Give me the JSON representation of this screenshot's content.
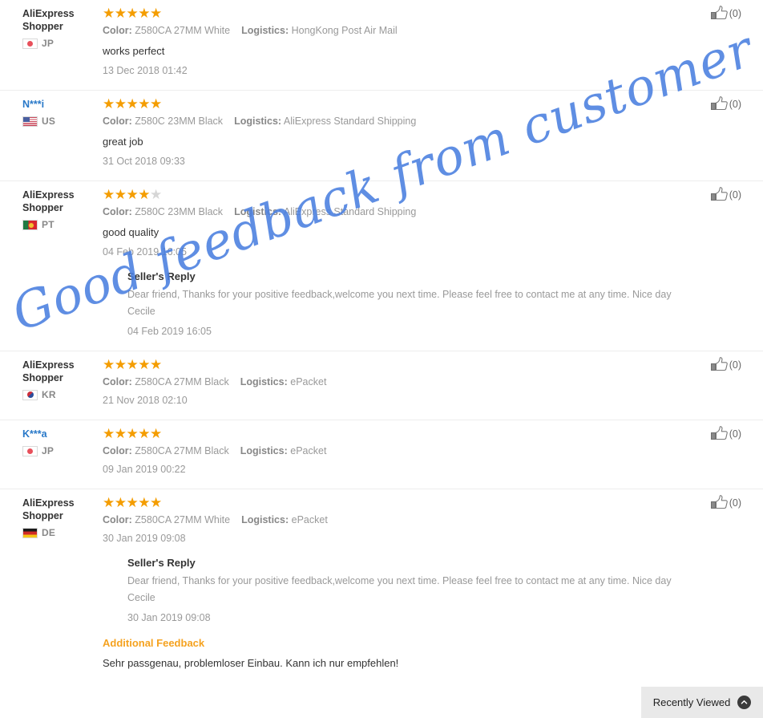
{
  "page": {
    "labels": {
      "color_key": "Color:",
      "logistics_key": "Logistics:",
      "sellers_reply": "Seller's Reply",
      "additional_feedback": "Additional Feedback",
      "helpful_icon": "thumbs-up-icon"
    },
    "colors": {
      "star_on": "#f49d00",
      "star_off": "#d6d6d6",
      "link": "#2878c8",
      "muted": "#999999",
      "accent_orange": "#f5a21f",
      "watermark": "#4a7fe0",
      "divider": "#ededed"
    }
  },
  "watermark": {
    "text": "Good feedback from customer"
  },
  "recently_viewed": {
    "label": "Recently Viewed",
    "icon": "chevron-up-icon"
  },
  "reviews": [
    {
      "user": "AliExpress Shopper",
      "user_is_link": false,
      "country_code": "JP",
      "flag": "flag-jp",
      "rating": 5,
      "color": "Z580CA 27MM White",
      "logistics": "HongKong Post Air Mail",
      "comment": "works perfect",
      "time": "13 Dec 2018 01:42",
      "helpful": "(0)",
      "reply": null,
      "additional": null
    },
    {
      "user": "N***i",
      "user_is_link": true,
      "country_code": "US",
      "flag": "flag-us",
      "rating": 5,
      "color": "Z580C 23MM Black",
      "logistics": "AliExpress Standard Shipping",
      "comment": "great job",
      "time": "31 Oct 2018 09:33",
      "helpful": "(0)",
      "reply": null,
      "additional": null
    },
    {
      "user": "AliExpress Shopper",
      "user_is_link": false,
      "country_code": "PT",
      "flag": "flag-pt",
      "rating": 4,
      "color": "Z580C 23MM Black",
      "logistics": "AliExpress Standard Shipping",
      "comment": "good quality",
      "time": "04 Feb 2019 16:05",
      "helpful": "(0)",
      "reply": {
        "title": "Seller's Reply",
        "body": "Dear friend, Thanks for your positive feedback,welcome you next time. Please feel free to contact me at any time. Nice day Cecile",
        "time": "04 Feb 2019 16:05"
      },
      "additional": null
    },
    {
      "user": "AliExpress Shopper",
      "user_is_link": false,
      "country_code": "KR",
      "flag": "flag-kr",
      "rating": 5,
      "color": "Z580CA 27MM Black",
      "logistics": "ePacket",
      "comment": "",
      "time": "21 Nov 2018 02:10",
      "helpful": "(0)",
      "reply": null,
      "additional": null
    },
    {
      "user": "K***a",
      "user_is_link": true,
      "country_code": "JP",
      "flag": "flag-jp",
      "rating": 5,
      "color": "Z580CA 27MM Black",
      "logistics": "ePacket",
      "comment": "",
      "time": "09 Jan 2019 00:22",
      "helpful": "(0)",
      "reply": null,
      "additional": null
    },
    {
      "user": "AliExpress Shopper",
      "user_is_link": false,
      "country_code": "DE",
      "flag": "flag-de",
      "rating": 5,
      "color": "Z580CA 27MM White",
      "logistics": "ePacket",
      "comment": "",
      "time": "30 Jan 2019 09:08",
      "helpful": "(0)",
      "reply": {
        "title": "Seller's Reply",
        "body": "Dear friend, Thanks for your positive feedback,welcome you next time. Please feel free to contact me at any time. Nice day Cecile",
        "time": "30 Jan 2019 09:08"
      },
      "additional": {
        "title": "Additional Feedback",
        "body": "Sehr passgenau, problemloser Einbau. Kann ich nur empfehlen!"
      }
    }
  ]
}
